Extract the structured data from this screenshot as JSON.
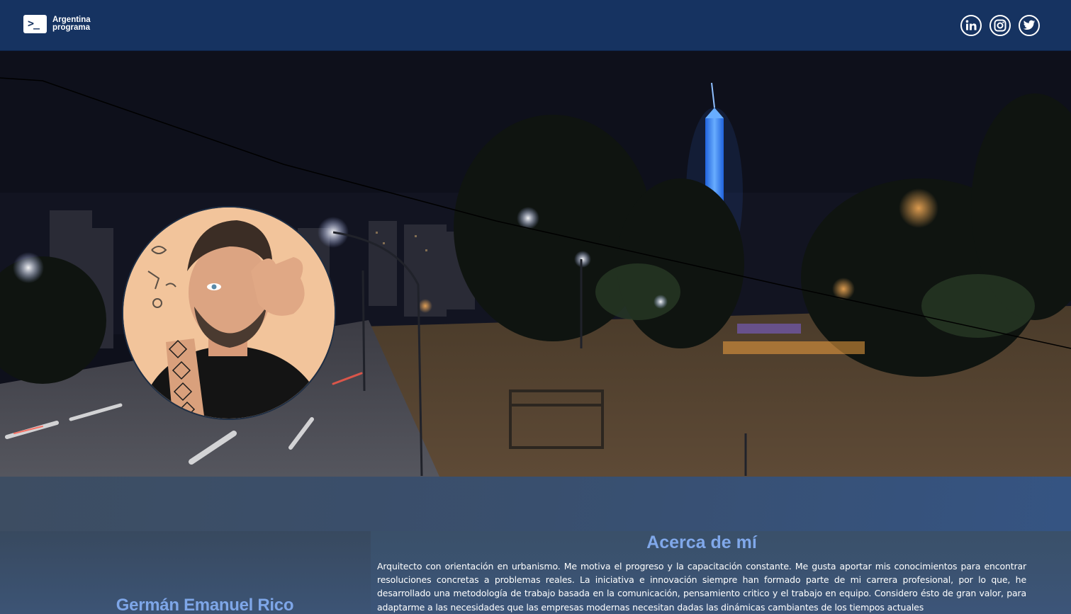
{
  "header": {
    "brand": {
      "icon": "terminal-prompt-icon",
      "line1": "Argentina",
      "line2": "programa"
    },
    "social": [
      {
        "name": "linkedin",
        "icon": "linkedin-icon"
      },
      {
        "name": "instagram",
        "icon": "instagram-icon"
      },
      {
        "name": "twitter",
        "icon": "twitter-icon"
      }
    ]
  },
  "hero": {
    "background": "night-city-park-photo",
    "avatar": "profile-photo"
  },
  "profile": {
    "name": "Germán Emanuel Rico"
  },
  "about": {
    "title": "Acerca de mí",
    "text": "Arquitecto con orientación en urbanismo. Me motiva el progreso y la capacitación constante. Me gusta aportar mis conocimientos para encontrar resoluciones concretas a problemas reales. La iniciativa e innovación siempre han formado parte de mi carrera profesional, por lo que, he desarrollado una metodología de trabajo basada en la comunicación, pensamiento critico y el trabajo en equipo. Considero ésto de gran valor, para adaptarme a las necesidades que las empresas modernas necesitan dadas las dinámicas cambiantes de los tiempos actuales"
  },
  "colors": {
    "header_bg": "#163361",
    "accent_text": "#7ea6e8",
    "body_text": "#ffffff"
  }
}
